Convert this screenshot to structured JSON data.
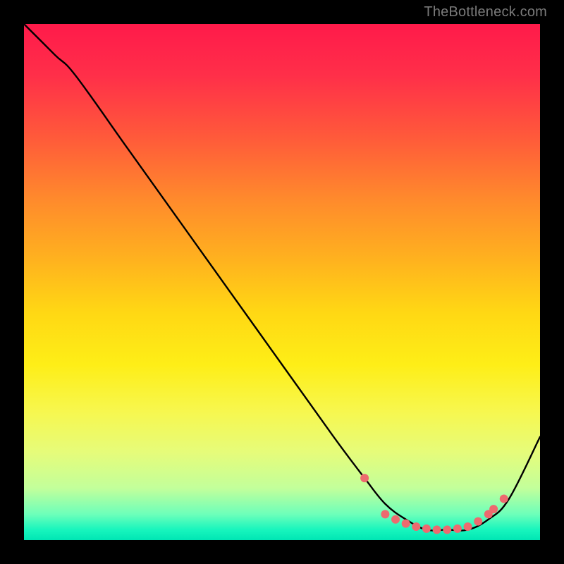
{
  "watermark": "TheBottleneck.com",
  "chart_data": {
    "type": "line",
    "title": "",
    "xlabel": "",
    "ylabel": "",
    "xlim": [
      0,
      100
    ],
    "ylim": [
      0,
      100
    ],
    "grid": false,
    "legend": false,
    "background": {
      "type": "vertical-gradient",
      "stops": [
        {
          "pos": 0,
          "color": "#ff1a4a"
        },
        {
          "pos": 22,
          "color": "#ff5a3a"
        },
        {
          "pos": 46,
          "color": "#ffb31e"
        },
        {
          "pos": 66,
          "color": "#feee17"
        },
        {
          "pos": 83,
          "color": "#e6fc7a"
        },
        {
          "pos": 95,
          "color": "#6dffba"
        },
        {
          "pos": 100,
          "color": "#00e6b4"
        }
      ]
    },
    "series": [
      {
        "name": "bottleneck-curve",
        "color": "#000000",
        "x": [
          0,
          6,
          10,
          20,
          30,
          40,
          50,
          60,
          66,
          70,
          74,
          78,
          82,
          86,
          90,
          94,
          100
        ],
        "y": [
          100,
          94,
          90,
          76,
          62,
          48,
          34,
          20,
          12,
          7,
          4,
          2,
          2,
          2,
          4,
          8,
          20
        ]
      }
    ],
    "markers": {
      "name": "highlight-dots",
      "color": "#ed6a6f",
      "radius": 6,
      "x": [
        66,
        70,
        72,
        74,
        76,
        78,
        80,
        82,
        84,
        86,
        88,
        90,
        91,
        93
      ],
      "y": [
        12,
        5,
        4,
        3.2,
        2.6,
        2.2,
        2.0,
        2.0,
        2.2,
        2.6,
        3.6,
        5.0,
        6.0,
        8.0
      ]
    }
  }
}
